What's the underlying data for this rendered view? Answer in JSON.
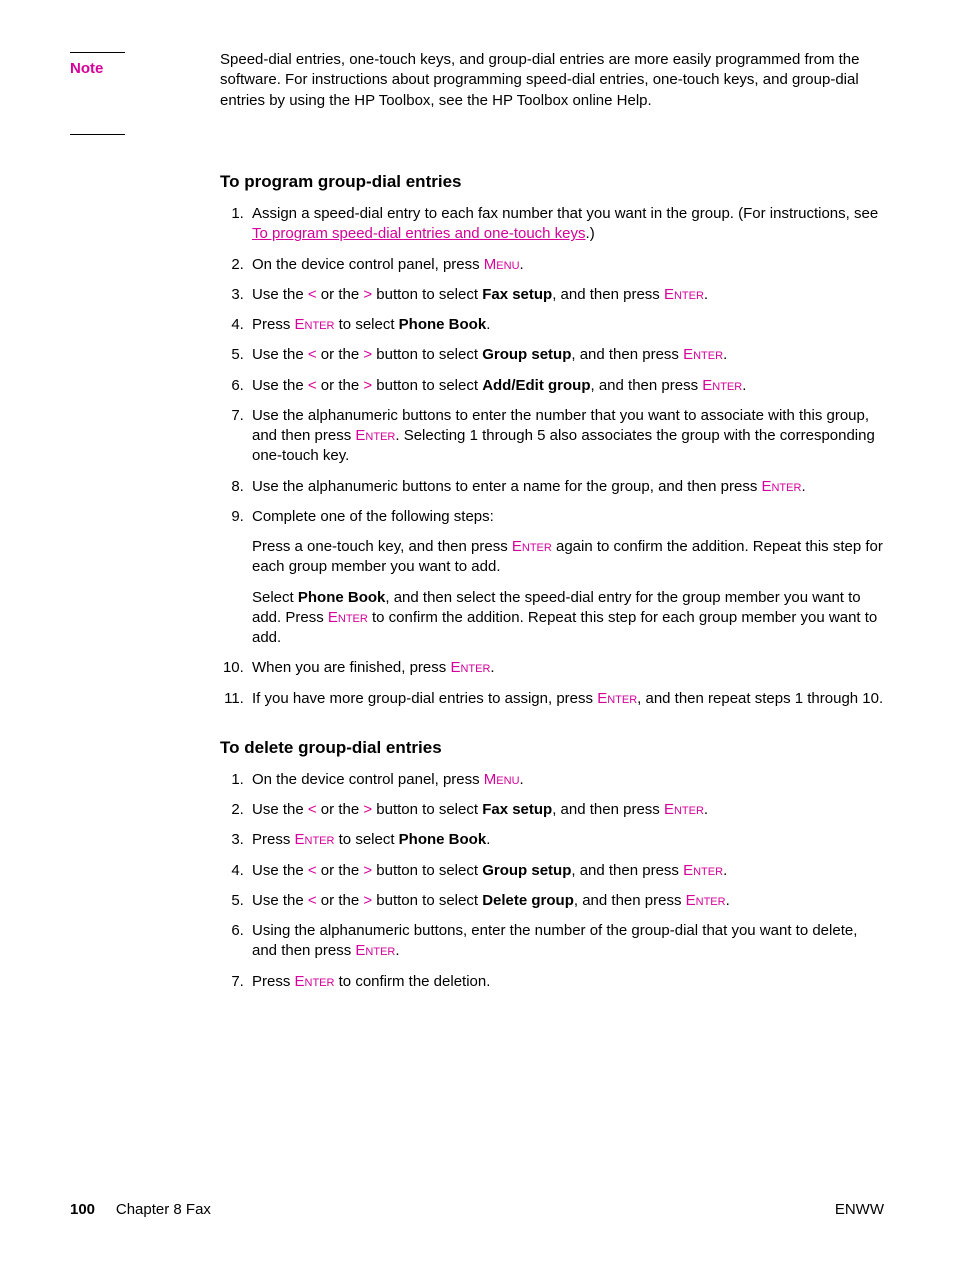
{
  "note": {
    "label": "Note",
    "body": "Speed-dial entries, one-touch keys, and group-dial entries are more easily programmed from the software. For instructions about programming speed-dial entries, one-touch keys, and group-dial entries by using the HP Toolbox, see the HP Toolbox online Help."
  },
  "keys": {
    "menu": "Menu",
    "enter": "Enter",
    "lt": "<",
    "gt": ">"
  },
  "section1": {
    "heading": "To program group-dial entries",
    "s1_a": "Assign a speed-dial entry to each fax number that you want in the group. (For instructions, see ",
    "s1_link": "To program speed-dial entries and one-touch keys",
    "s1_b": ".)",
    "s2_a": "On the device control panel, press ",
    "s2_b": ".",
    "s3_a": "Use the ",
    "s3_b": " or the ",
    "s3_c": " button to select ",
    "s3_bold": "Fax setup",
    "s3_d": ", and then press ",
    "s3_e": ".",
    "s4_a": "Press ",
    "s4_b": " to select ",
    "s4_bold": "Phone Book",
    "s4_c": ".",
    "s5_a": "Use the ",
    "s5_b": " or the ",
    "s5_c": " button to select ",
    "s5_bold": "Group setup",
    "s5_d": ", and then press ",
    "s5_e": ".",
    "s6_a": "Use the ",
    "s6_b": " or the ",
    "s6_c": " button to select ",
    "s6_bold": "Add/Edit group",
    "s6_d": ", and then press ",
    "s6_e": ".",
    "s7_a": "Use the alphanumeric buttons to enter the number that you want to associate with this group, and then press ",
    "s7_b": ". Selecting 1 through 5 also associates the group with the corresponding one-touch key.",
    "s8_a": "Use the alphanumeric buttons to enter a name for the group, and then press ",
    "s8_b": ".",
    "s9_a": "Complete one of the following steps:",
    "s9_p1a": "Press a one-touch key, and then press ",
    "s9_p1b": " again to confirm the addition. Repeat this step for each group member you want to add.",
    "s9_p2a": "Select ",
    "s9_p2bold": "Phone Book",
    "s9_p2b": ", and then select the speed-dial entry for the group member you want to add. Press ",
    "s9_p2c": " to confirm the addition. Repeat this step for each group member you want to add.",
    "s10_a": "When you are finished, press ",
    "s10_b": ".",
    "s11_a": "If you have more group-dial entries to assign, press ",
    "s11_b": ", and then repeat steps 1 through 10."
  },
  "section2": {
    "heading": "To delete group-dial entries",
    "s1_a": "On the device control panel, press ",
    "s1_b": ".",
    "s2_a": "Use the ",
    "s2_b": " or the ",
    "s2_c": " button to select ",
    "s2_bold": "Fax setup",
    "s2_d": ", and then press ",
    "s2_e": ".",
    "s3_a": "Press ",
    "s3_b": " to select ",
    "s3_bold": "Phone Book",
    "s3_c": ".",
    "s4_a": "Use the ",
    "s4_b": " or the ",
    "s4_c": " button to select ",
    "s4_bold": "Group setup",
    "s4_d": ", and then press ",
    "s4_e": ".",
    "s5_a": "Use the ",
    "s5_b": " or the ",
    "s5_c": " button to select ",
    "s5_bold": "Delete group",
    "s5_d": ", and then press ",
    "s5_e": ".",
    "s6_a": "Using the alphanumeric buttons, enter the number of the group-dial that you want to delete, and then press ",
    "s6_b": ".",
    "s7_a": "Press ",
    "s7_b": " to confirm the deletion."
  },
  "footer": {
    "page_num": "100",
    "chapter": "Chapter 8  Fax",
    "right": "ENWW"
  }
}
